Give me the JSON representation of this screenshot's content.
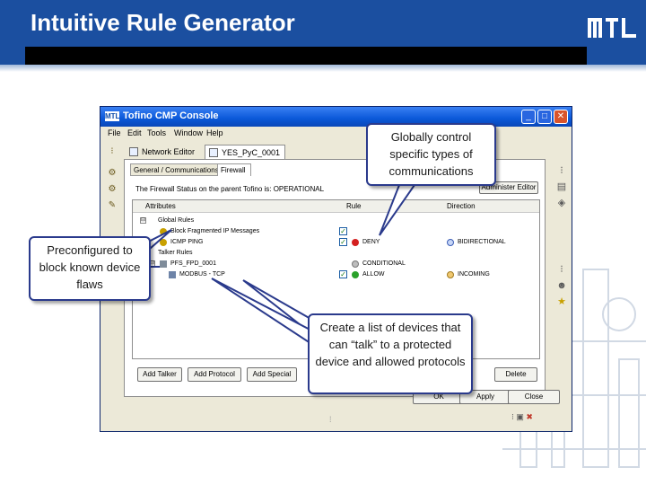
{
  "slide": {
    "title": "Intuitive Rule Generator",
    "logo_text": "MTL",
    "colors": {
      "header": "#1b4fa0",
      "header_bar": "#000000",
      "callout_border": "#2a3a8c"
    }
  },
  "window": {
    "title": "Tofino CMP Console",
    "app_icon": "MTL",
    "menu": [
      "File",
      "Edit",
      "Tools",
      "Window",
      "Help"
    ],
    "editor_tabs": [
      {
        "label": "Network Editor",
        "icon": "network-icon"
      },
      {
        "label": "YES_PyC_0001",
        "icon": "device-icon",
        "close": "✕"
      }
    ],
    "sub_tabs": [
      "General / Communications",
      "Firewall"
    ],
    "status_line": "The Firewall Status on the parent Tofino is: OPERATIONAL",
    "admin_button": "Administer Editor",
    "table": {
      "headers": [
        "Attributes",
        "Rule",
        "Direction"
      ],
      "rows": [
        {
          "label": "Global Rules",
          "expand": "⊟"
        },
        {
          "label": "Block Fragmented IP Messages",
          "rule": "",
          "direction": ""
        },
        {
          "label": "ICMP PING",
          "rule": "DENY",
          "direction": "BIDIRECTIONAL"
        },
        {
          "label": "Talker Rules",
          "expand": "⊟"
        },
        {
          "label": "PFS_FPD_0001",
          "rule": "CONDITIONAL",
          "direction": ""
        },
        {
          "label": "MODBUS - TCP",
          "rule": "ALLOW",
          "direction": "INCOMING"
        }
      ]
    },
    "buttons": [
      "Add Talker",
      "Add Protocol",
      "Add Special",
      "Delete"
    ],
    "dialog_buttons": [
      "OK",
      "Apply",
      "Close"
    ],
    "check_mark": "✓"
  },
  "callouts": {
    "globally": "Globally control specific types of communications",
    "preconfigured": "Preconfigured to block known device flaws",
    "create": "Create a list of devices that can “talk” to a protected device and allowed protocols"
  },
  "icons": [
    "restore-icon",
    "minimize-icon",
    "maximize-icon",
    "close-icon"
  ]
}
